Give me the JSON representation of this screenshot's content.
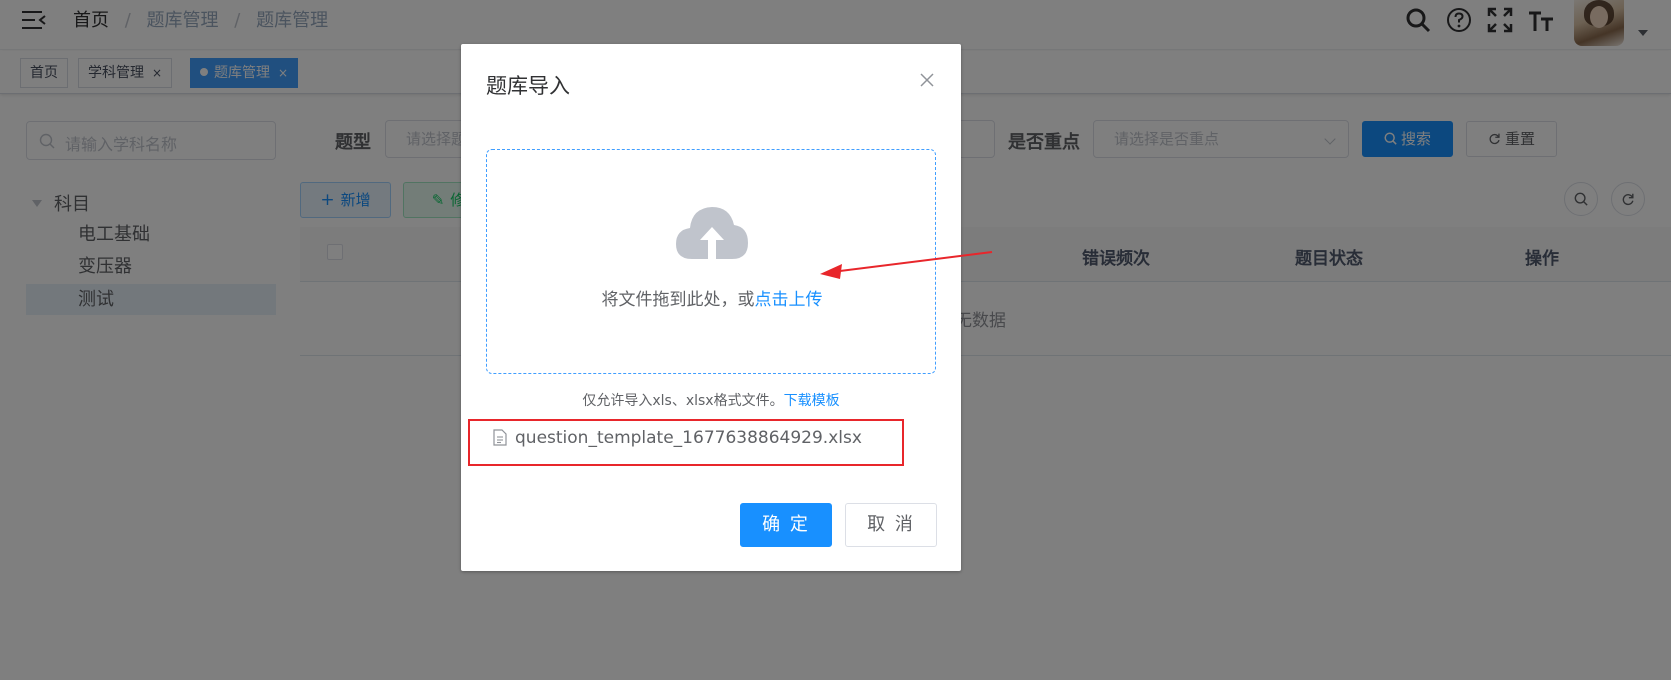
{
  "navbar": {
    "breadcrumb": [
      "首页",
      "题库管理",
      "题库管理"
    ],
    "separator": "/",
    "icons": [
      "search-icon",
      "help-icon",
      "fullscreen-icon",
      "font-size-icon"
    ]
  },
  "tags": [
    {
      "label": "首页",
      "active": false,
      "closable": false
    },
    {
      "label": "学科管理",
      "active": false,
      "closable": true
    },
    {
      "label": "题库管理",
      "active": true,
      "closable": true
    }
  ],
  "tag_close": "×",
  "sidebar": {
    "search_placeholder": "请输入学科名称",
    "root": "科目",
    "nodes": [
      {
        "label": "电工基础",
        "selected": false
      },
      {
        "label": "变压器",
        "selected": false
      },
      {
        "label": "测试",
        "selected": true
      }
    ]
  },
  "filters": {
    "type_label": "题型",
    "type_placeholder": "请选择题",
    "key_label": "是否重点",
    "key_placeholder": "请选择是否重点",
    "search_btn": "搜索",
    "reset_btn": "重置"
  },
  "toolbar": {
    "add_btn": "新增",
    "edit_btn": "修"
  },
  "table": {
    "columns": [
      "错误频次",
      "题目状态",
      "操作"
    ],
    "empty": "无数据"
  },
  "dialog": {
    "title": "题库导入",
    "upload_text": "将文件拖到此处，或",
    "upload_link": "点击上传",
    "tip": "仅允许导入xls、xlsx格式文件。",
    "tip_link": "下载模板",
    "file_name": "question_template_1677638864929.xlsx",
    "ok_btn": "确 定",
    "cancel_btn": "取 消"
  },
  "colors": {
    "primary": "#1890ff",
    "annotation_red": "#e8262b",
    "mask": "rgba(0,0,0,0.5)"
  }
}
